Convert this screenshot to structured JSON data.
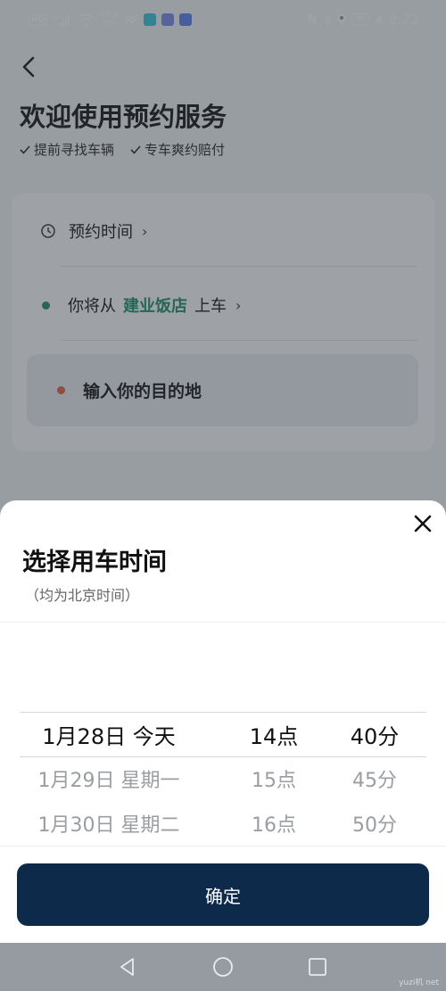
{
  "status_bar": {
    "network_badge": "HD",
    "signal_label": "4G",
    "speed": "43.6",
    "speed_unit": "K/s",
    "battery": "96",
    "time": "2:22"
  },
  "page": {
    "title": "欢迎使用预约服务",
    "features": [
      "提前寻找车辆",
      "专车爽约赔付"
    ],
    "card": {
      "time_label": "预约时间",
      "from_prefix": "你将从",
      "from_place": "建业饭店",
      "from_suffix": "上车",
      "destination_placeholder": "输入你的目的地"
    }
  },
  "sheet": {
    "title": "选择用车时间",
    "subtitle": "（均为北京时间）",
    "picker": {
      "dates": [
        "1月28日 今天",
        "1月29日 星期一",
        "1月30日 星期二"
      ],
      "hours": [
        "14点",
        "15点",
        "16点"
      ],
      "minutes": [
        "40分",
        "45分",
        "50分"
      ],
      "selected_index": 0
    },
    "confirm_label": "确定"
  },
  "watermark": "yuzi机 net",
  "colors": {
    "accent_green": "#1b8a62",
    "origin_dot": "#1b8a62",
    "destination_dot": "#e0603a",
    "confirm_button": "#0d2a4a"
  },
  "icons": {
    "back": "chevron-left-icon",
    "clock": "clock-icon",
    "check": "check-icon",
    "close": "close-icon",
    "nav_back": "triangle-back-icon",
    "nav_home": "circle-home-icon",
    "nav_recent": "square-recent-icon"
  }
}
